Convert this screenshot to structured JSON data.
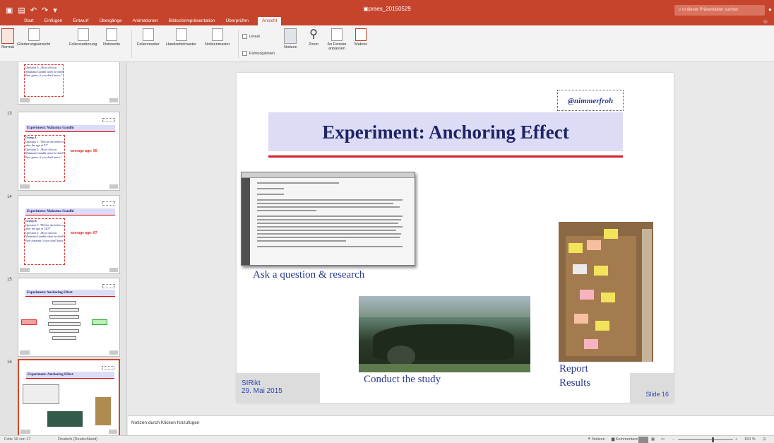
{
  "titlebar": {
    "title": "praes_20150529",
    "search_placeholder": "In dieser Präsentation suchen"
  },
  "tabs": [
    "Start",
    "Einfügen",
    "Entwurf",
    "Übergänge",
    "Animationen",
    "Bildschirmpräsentation",
    "Überprüfen",
    "Ansicht"
  ],
  "ribbon": {
    "views": [
      "Normal",
      "Gliederungsansicht",
      "Foliensortierung",
      "Notizseite"
    ],
    "masters": [
      "Folienmaster",
      "Handzettelmaster",
      "Notizenmaster"
    ],
    "show": [
      "Lineal",
      "Führungslinien"
    ],
    "tools": [
      "Notizen",
      "Zoom",
      "An Fenster anpassen",
      "Makros"
    ]
  },
  "sidebar": {
    "slide_numbers": [
      "13",
      "14",
      "15",
      "16"
    ],
    "s13": {
      "title": "Experiment: Mahatma Gandhi",
      "group": "Group A",
      "q1": "Question 1: \"Did he die before or after the age of 9?\"",
      "q2": "Question 2: „How old was Mahatma Gandhi when he died? Best guess, if you don't know.\"",
      "answer": "average age: 50"
    },
    "s14": {
      "title": "Experiment: Mahatma Gandhi",
      "group": "Group B",
      "q1": "Question 1: \"Did he die before or after the age of 140?\"",
      "q2": "Question 2: „How old was Mahatma Gandhi when he died? Best estimate, if you don't know.\"",
      "answer": "average age: 67"
    },
    "s15": {
      "title": "Experiment: Anchoring Effect"
    },
    "s16": {
      "title": "Experiment: Anchoring Effect"
    }
  },
  "slide": {
    "tag": "@nimmerfroh",
    "title": "Experiment: Anchoring Effect",
    "caption1": "Ask a question & research",
    "caption2": "Conduct the study",
    "caption3a": "Report",
    "caption3b": "Results",
    "footer_org": "SIRikt",
    "footer_date": "29. Mai 2015",
    "slide_number": "Slide 16"
  },
  "notes": {
    "placeholder": "Notizen durch Klicken hinzufügen"
  },
  "statusbar": {
    "slide_info": "Folie 16 von 17",
    "language": "Deutsch (Deutschland)",
    "notes_btn": "Notizen",
    "comments_btn": "Kommentare",
    "zoom": "150 %"
  },
  "colors": {
    "accent": "#c6432c",
    "title_fill": "#dcdcf6",
    "title_text": "#1f2466",
    "rule_red": "#d51d2c",
    "caption_blue": "#2a3a8f"
  }
}
